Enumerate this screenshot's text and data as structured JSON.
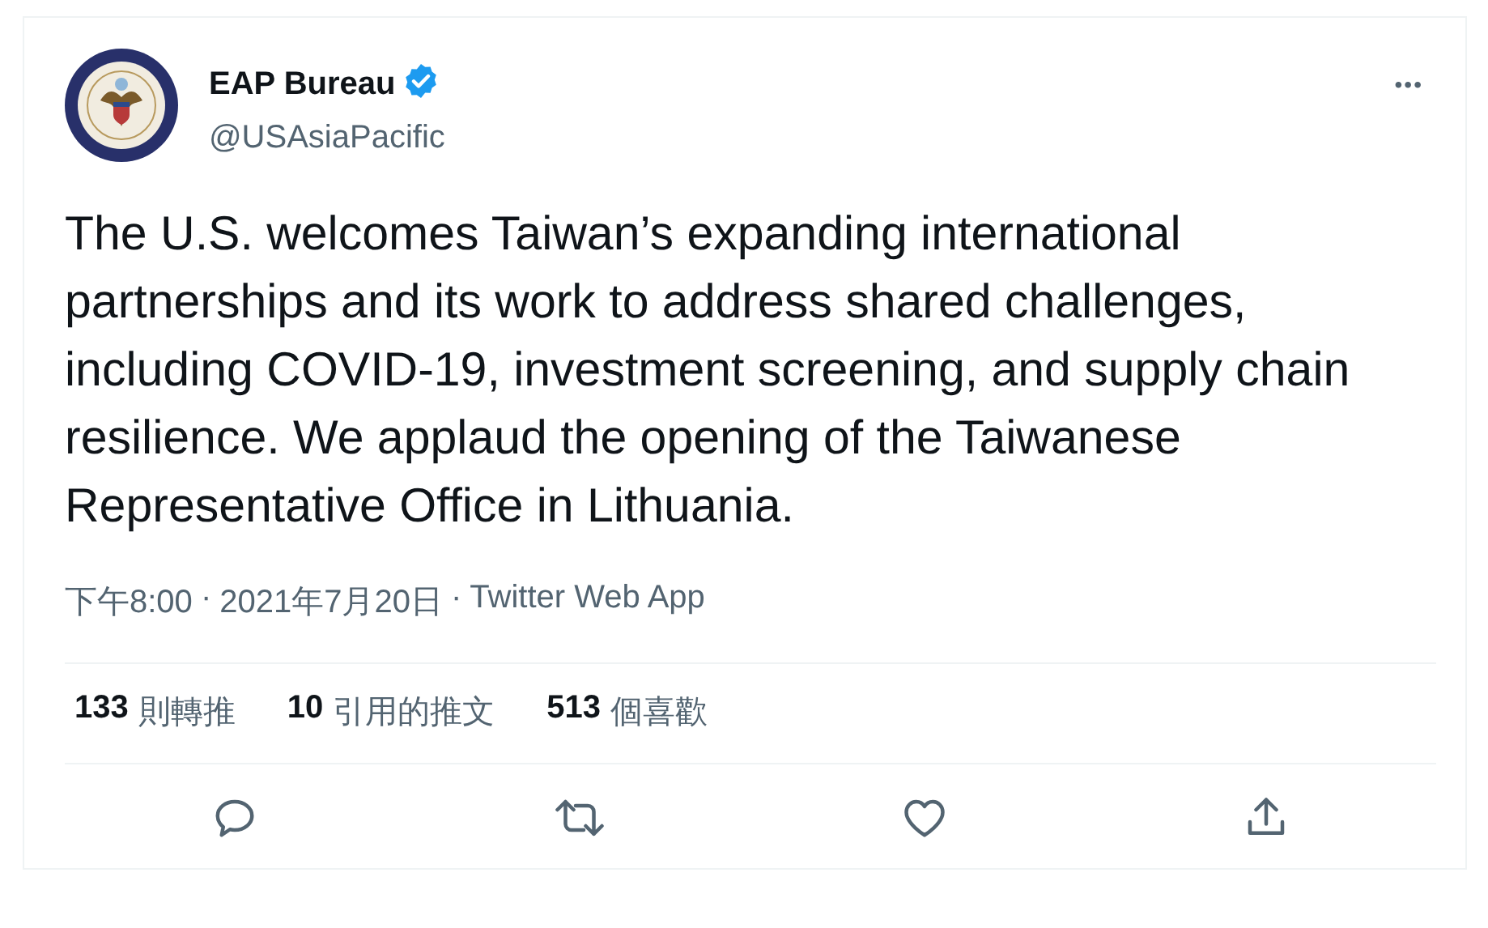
{
  "author": {
    "name": "EAP Bureau",
    "verified": true,
    "handle": "@USAsiaPacific"
  },
  "text": "The U.S. welcomes Taiwan’s expanding international partnerships and its work to address shared challenges, including COVID-19, investment screening, and supply chain resilience. We applaud the opening of the Taiwanese Representative Office in Lithuania.",
  "meta": [
    "下午8:00",
    "2021年7月20日",
    "Twitter Web App"
  ],
  "meta_separator": "·",
  "more_menu": "•••",
  "stats": [
    {
      "count": "133",
      "label": "則轉推"
    },
    {
      "count": "10",
      "label": "引用的推文"
    },
    {
      "count": "513",
      "label": "個喜歡"
    }
  ],
  "actions": [
    {
      "kind": "reply"
    },
    {
      "kind": "retweet"
    },
    {
      "kind": "like"
    },
    {
      "kind": "share"
    }
  ]
}
